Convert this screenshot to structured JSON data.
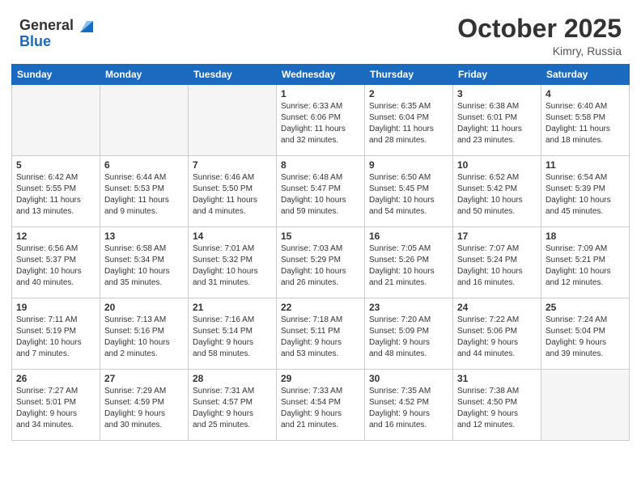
{
  "header": {
    "logo_general": "General",
    "logo_blue": "Blue",
    "month": "October 2025",
    "location": "Kimry, Russia"
  },
  "days_of_week": [
    "Sunday",
    "Monday",
    "Tuesday",
    "Wednesday",
    "Thursday",
    "Friday",
    "Saturday"
  ],
  "weeks": [
    [
      {
        "day": "",
        "info": ""
      },
      {
        "day": "",
        "info": ""
      },
      {
        "day": "",
        "info": ""
      },
      {
        "day": "1",
        "info": "Sunrise: 6:33 AM\nSunset: 6:06 PM\nDaylight: 11 hours\nand 32 minutes."
      },
      {
        "day": "2",
        "info": "Sunrise: 6:35 AM\nSunset: 6:04 PM\nDaylight: 11 hours\nand 28 minutes."
      },
      {
        "day": "3",
        "info": "Sunrise: 6:38 AM\nSunset: 6:01 PM\nDaylight: 11 hours\nand 23 minutes."
      },
      {
        "day": "4",
        "info": "Sunrise: 6:40 AM\nSunset: 5:58 PM\nDaylight: 11 hours\nand 18 minutes."
      }
    ],
    [
      {
        "day": "5",
        "info": "Sunrise: 6:42 AM\nSunset: 5:55 PM\nDaylight: 11 hours\nand 13 minutes."
      },
      {
        "day": "6",
        "info": "Sunrise: 6:44 AM\nSunset: 5:53 PM\nDaylight: 11 hours\nand 9 minutes."
      },
      {
        "day": "7",
        "info": "Sunrise: 6:46 AM\nSunset: 5:50 PM\nDaylight: 11 hours\nand 4 minutes."
      },
      {
        "day": "8",
        "info": "Sunrise: 6:48 AM\nSunset: 5:47 PM\nDaylight: 10 hours\nand 59 minutes."
      },
      {
        "day": "9",
        "info": "Sunrise: 6:50 AM\nSunset: 5:45 PM\nDaylight: 10 hours\nand 54 minutes."
      },
      {
        "day": "10",
        "info": "Sunrise: 6:52 AM\nSunset: 5:42 PM\nDaylight: 10 hours\nand 50 minutes."
      },
      {
        "day": "11",
        "info": "Sunrise: 6:54 AM\nSunset: 5:39 PM\nDaylight: 10 hours\nand 45 minutes."
      }
    ],
    [
      {
        "day": "12",
        "info": "Sunrise: 6:56 AM\nSunset: 5:37 PM\nDaylight: 10 hours\nand 40 minutes."
      },
      {
        "day": "13",
        "info": "Sunrise: 6:58 AM\nSunset: 5:34 PM\nDaylight: 10 hours\nand 35 minutes."
      },
      {
        "day": "14",
        "info": "Sunrise: 7:01 AM\nSunset: 5:32 PM\nDaylight: 10 hours\nand 31 minutes."
      },
      {
        "day": "15",
        "info": "Sunrise: 7:03 AM\nSunset: 5:29 PM\nDaylight: 10 hours\nand 26 minutes."
      },
      {
        "day": "16",
        "info": "Sunrise: 7:05 AM\nSunset: 5:26 PM\nDaylight: 10 hours\nand 21 minutes."
      },
      {
        "day": "17",
        "info": "Sunrise: 7:07 AM\nSunset: 5:24 PM\nDaylight: 10 hours\nand 16 minutes."
      },
      {
        "day": "18",
        "info": "Sunrise: 7:09 AM\nSunset: 5:21 PM\nDaylight: 10 hours\nand 12 minutes."
      }
    ],
    [
      {
        "day": "19",
        "info": "Sunrise: 7:11 AM\nSunset: 5:19 PM\nDaylight: 10 hours\nand 7 minutes."
      },
      {
        "day": "20",
        "info": "Sunrise: 7:13 AM\nSunset: 5:16 PM\nDaylight: 10 hours\nand 2 minutes."
      },
      {
        "day": "21",
        "info": "Sunrise: 7:16 AM\nSunset: 5:14 PM\nDaylight: 9 hours\nand 58 minutes."
      },
      {
        "day": "22",
        "info": "Sunrise: 7:18 AM\nSunset: 5:11 PM\nDaylight: 9 hours\nand 53 minutes."
      },
      {
        "day": "23",
        "info": "Sunrise: 7:20 AM\nSunset: 5:09 PM\nDaylight: 9 hours\nand 48 minutes."
      },
      {
        "day": "24",
        "info": "Sunrise: 7:22 AM\nSunset: 5:06 PM\nDaylight: 9 hours\nand 44 minutes."
      },
      {
        "day": "25",
        "info": "Sunrise: 7:24 AM\nSunset: 5:04 PM\nDaylight: 9 hours\nand 39 minutes."
      }
    ],
    [
      {
        "day": "26",
        "info": "Sunrise: 7:27 AM\nSunset: 5:01 PM\nDaylight: 9 hours\nand 34 minutes."
      },
      {
        "day": "27",
        "info": "Sunrise: 7:29 AM\nSunset: 4:59 PM\nDaylight: 9 hours\nand 30 minutes."
      },
      {
        "day": "28",
        "info": "Sunrise: 7:31 AM\nSunset: 4:57 PM\nDaylight: 9 hours\nand 25 minutes."
      },
      {
        "day": "29",
        "info": "Sunrise: 7:33 AM\nSunset: 4:54 PM\nDaylight: 9 hours\nand 21 minutes."
      },
      {
        "day": "30",
        "info": "Sunrise: 7:35 AM\nSunset: 4:52 PM\nDaylight: 9 hours\nand 16 minutes."
      },
      {
        "day": "31",
        "info": "Sunrise: 7:38 AM\nSunset: 4:50 PM\nDaylight: 9 hours\nand 12 minutes."
      },
      {
        "day": "",
        "info": ""
      }
    ]
  ]
}
